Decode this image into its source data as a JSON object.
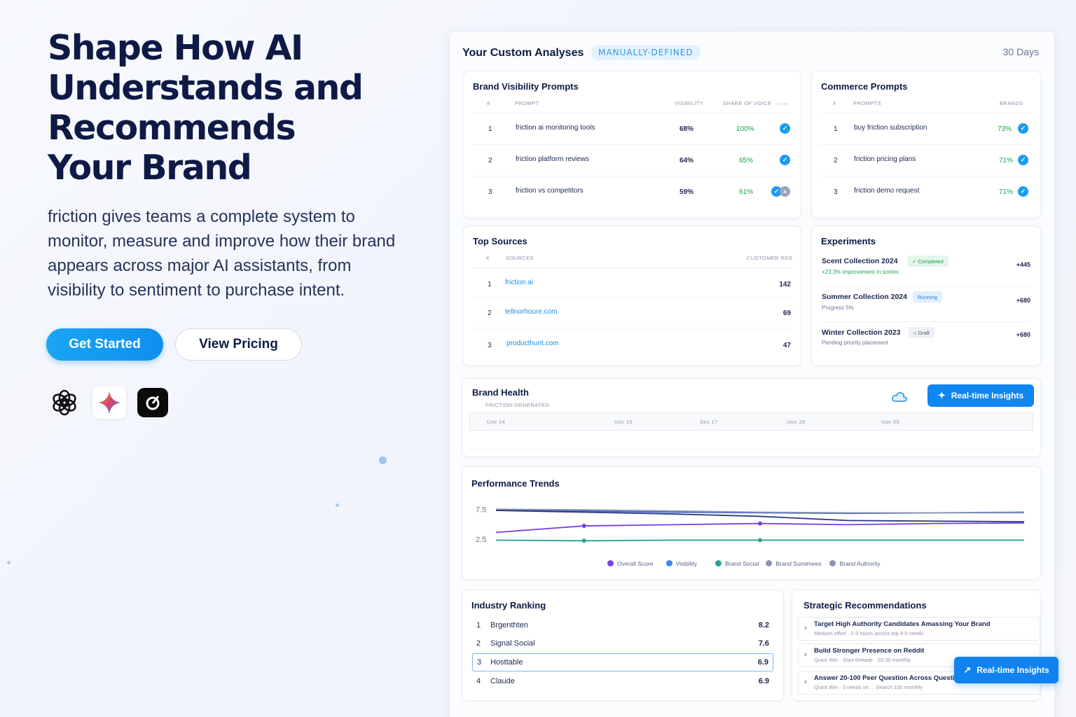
{
  "hero": {
    "title_line1": "Shape How AI",
    "title_line2": "Understands and",
    "title_line3": "Recommends",
    "title_line4": "Your Brand",
    "subtitle_line1": "friction gives teams a complete system to",
    "subtitle_line2": "monitor, measure and improve how their brand",
    "subtitle_line3": "appears across major AI assistants, from",
    "subtitle_line4": "visibility to sentiment to purchase intent.",
    "get_started": "Get Started",
    "view_pricing": "View Pricing"
  },
  "panel": {
    "title": "Your Custom Analyses",
    "chip": "MANUALLY-DEFINED",
    "range": "30 Days"
  },
  "brand_visibility": {
    "title": "Brand Visibility Prompts",
    "headers": {
      "num": "#",
      "prompt": "PROMPT",
      "visibility": "VISIBILITY",
      "sov": "SHARE OF VOICE",
      "extra": "— —"
    },
    "rows": [
      {
        "n": "1",
        "prompt": "friction ai monitoring tools",
        "visibility": "68%",
        "sov": "100%"
      },
      {
        "n": "2",
        "prompt": "friction platform reviews",
        "visibility": "64%",
        "sov": "65%"
      },
      {
        "n": "3",
        "prompt": "friction vs competitors",
        "visibility": "59%",
        "sov": "61%"
      }
    ]
  },
  "commerce": {
    "title": "Commerce Prompts",
    "headers": {
      "num": "#",
      "prompt": "PROMPTS",
      "brands": "BRANDS"
    },
    "rows": [
      {
        "n": "1",
        "prompt": "buy friction subscription",
        "value": "73%"
      },
      {
        "n": "2",
        "prompt": "friction pricing plans",
        "value": "71%"
      },
      {
        "n": "3",
        "prompt": "friction demo request",
        "value": "71%"
      }
    ]
  },
  "sources": {
    "title": "Top Sources",
    "headers": {
      "num": "#",
      "sources": "SOURCES",
      "count": "CUSTOMER RDS"
    },
    "rows": [
      {
        "n": "1",
        "source": "friction.ai",
        "count": "142"
      },
      {
        "n": "2",
        "source": "tellnorhoure.com",
        "count": "69"
      },
      {
        "n": "3",
        "source": "producthunt.com",
        "count": "47"
      }
    ]
  },
  "experiments": {
    "title": "Experiments",
    "rows": [
      {
        "name": "Scent Collection 2024",
        "badge": "✓ Completed",
        "sub": "+23.3% improvement in sorties",
        "value": "+445"
      },
      {
        "name": "Summer Collection 2024",
        "badge": "Running",
        "sub": "Progress 5%",
        "value": "+680"
      },
      {
        "name": "Winter Collection 2023",
        "badge": "○ Draft",
        "sub": "Pending priority placement",
        "value": "+680"
      }
    ]
  },
  "brand_health": {
    "title": "Brand Health",
    "sub": "FRICTION-GENERATED",
    "button": "Real-time Insights",
    "dates": [
      "Uoc 14",
      "Uoc 16",
      "Sos 17",
      "Uon 28",
      "Uoc 05"
    ]
  },
  "performance": {
    "title": "Performance Trends",
    "legend": [
      "Overall Score",
      "Visibility",
      "Brand Social",
      "Brand Sumimees",
      "Brand Authority"
    ]
  },
  "chart_data": {
    "type": "line",
    "title": "Performance Trends",
    "y_ticks": [
      "7.5",
      "2.5"
    ],
    "ylim": [
      0,
      10
    ],
    "x": [
      0,
      1,
      2,
      3,
      4,
      5,
      6
    ],
    "series": [
      {
        "name": "Overall Score",
        "color": "#7b3fe4",
        "values": [
          3.6,
          4.7,
          4.9,
          5.1,
          4.9,
          5.1,
          5.2
        ]
      },
      {
        "name": "Visibility",
        "color": "#3c62d6",
        "values": [
          7.4,
          7.2,
          7.0,
          6.9,
          6.8,
          6.9,
          7.0
        ]
      },
      {
        "name": "Brand Social",
        "color": "#2aa198",
        "values": [
          2.3,
          2.2,
          2.3,
          2.3,
          2.3,
          2.3,
          2.3
        ]
      },
      {
        "name": "Brand Sumimees",
        "color": "#8a94ad",
        "values": [
          7.5,
          7.4,
          7.2,
          7.0,
          6.9,
          6.9,
          6.9
        ]
      },
      {
        "name": "Brand Authority",
        "color": "#2d3b7a",
        "values": [
          7.3,
          7.0,
          6.7,
          6.3,
          5.6,
          5.5,
          5.4
        ]
      }
    ]
  },
  "ranking": {
    "title": "Industry Ranking",
    "rows": [
      {
        "n": "1",
        "name": "Brgenthten",
        "score": "8.2"
      },
      {
        "n": "2",
        "name": "Signal Social",
        "score": "7.6"
      },
      {
        "n": "3",
        "name": "Hosttable",
        "score": "6.9"
      },
      {
        "n": "4",
        "name": "Claude",
        "score": "6.9"
      }
    ]
  },
  "recommendations": {
    "title": "Strategic Recommendations",
    "rows": [
      {
        "title": "Target High Authority Candidates Amassing Your Brand",
        "sub": "Medium effort · 2-3 hours across top 4-5 needs"
      },
      {
        "title": "Build Stronger Presence on Reddit",
        "sub": "Quick Win · Start threads · 25-30 monthly"
      },
      {
        "title": "Answer 20-100 Peer Question Across Question",
        "sub": "Quick Win · 3 needs on ... Search 100 monthly"
      }
    ]
  },
  "floating_button": "Real-time Insights"
}
